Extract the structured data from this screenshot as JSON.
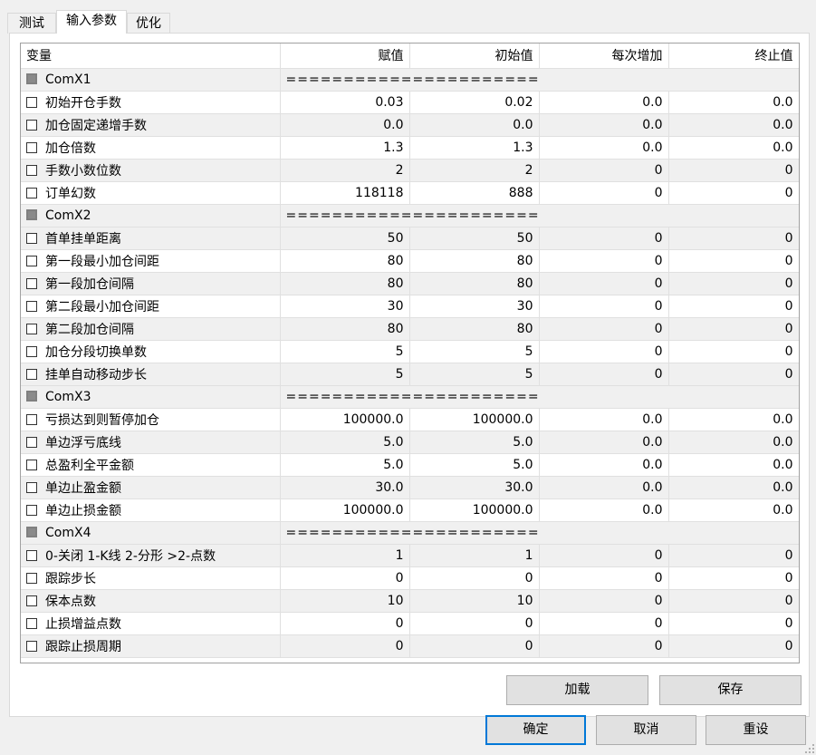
{
  "tabs": [
    {
      "label": "测试"
    },
    {
      "label": "输入参数"
    },
    {
      "label": "优化"
    }
  ],
  "table": {
    "headers": [
      "变量",
      "赋值",
      "初始值",
      "每次增加",
      "终止值"
    ],
    "separator": "=========================",
    "rows": [
      {
        "type": "group",
        "name": "ComX1"
      },
      {
        "type": "param",
        "name": "初始开仓手数",
        "value": "0.03",
        "start": "0.02",
        "step": "0.0",
        "stop": "0.0"
      },
      {
        "type": "param",
        "name": "加仓固定递增手数",
        "value": "0.0",
        "start": "0.0",
        "step": "0.0",
        "stop": "0.0"
      },
      {
        "type": "param",
        "name": "加仓倍数",
        "value": "1.3",
        "start": "1.3",
        "step": "0.0",
        "stop": "0.0"
      },
      {
        "type": "param",
        "name": "手数小数位数",
        "value": "2",
        "start": "2",
        "step": "0",
        "stop": "0"
      },
      {
        "type": "param",
        "name": "订单幻数",
        "value": "118118",
        "start": "888",
        "step": "0",
        "stop": "0"
      },
      {
        "type": "group",
        "name": "ComX2"
      },
      {
        "type": "param",
        "name": "首单挂单距离",
        "value": "50",
        "start": "50",
        "step": "0",
        "stop": "0"
      },
      {
        "type": "param",
        "name": "第一段最小加仓间距",
        "value": "80",
        "start": "80",
        "step": "0",
        "stop": "0"
      },
      {
        "type": "param",
        "name": "第一段加仓间隔",
        "value": "80",
        "start": "80",
        "step": "0",
        "stop": "0"
      },
      {
        "type": "param",
        "name": "第二段最小加仓间距",
        "value": "30",
        "start": "30",
        "step": "0",
        "stop": "0"
      },
      {
        "type": "param",
        "name": "第二段加仓间隔",
        "value": "80",
        "start": "80",
        "step": "0",
        "stop": "0"
      },
      {
        "type": "param",
        "name": "加仓分段切换单数",
        "value": "5",
        "start": "5",
        "step": "0",
        "stop": "0"
      },
      {
        "type": "param",
        "name": "挂单自动移动步长",
        "value": "5",
        "start": "5",
        "step": "0",
        "stop": "0"
      },
      {
        "type": "group",
        "name": "ComX3"
      },
      {
        "type": "param",
        "name": "亏损达到则暂停加仓",
        "value": "100000.0",
        "start": "100000.0",
        "step": "0.0",
        "stop": "0.0"
      },
      {
        "type": "param",
        "name": "单边浮亏底线",
        "value": "5.0",
        "start": "5.0",
        "step": "0.0",
        "stop": "0.0"
      },
      {
        "type": "param",
        "name": "总盈利全平金额",
        "value": "5.0",
        "start": "5.0",
        "step": "0.0",
        "stop": "0.0"
      },
      {
        "type": "param",
        "name": "单边止盈金额",
        "value": "30.0",
        "start": "30.0",
        "step": "0.0",
        "stop": "0.0"
      },
      {
        "type": "param",
        "name": "单边止损金额",
        "value": "100000.0",
        "start": "100000.0",
        "step": "0.0",
        "stop": "0.0"
      },
      {
        "type": "group",
        "name": "ComX4"
      },
      {
        "type": "param",
        "name": "0-关闭 1-K线 2-分形 >2-点数",
        "value": "1",
        "start": "1",
        "step": "0",
        "stop": "0"
      },
      {
        "type": "param",
        "name": "跟踪步长",
        "value": "0",
        "start": "0",
        "step": "0",
        "stop": "0"
      },
      {
        "type": "param",
        "name": "保本点数",
        "value": "10",
        "start": "10",
        "step": "0",
        "stop": "0"
      },
      {
        "type": "param",
        "name": "止损增益点数",
        "value": "0",
        "start": "0",
        "step": "0",
        "stop": "0"
      },
      {
        "type": "param",
        "name": "跟踪止损周期",
        "value": "0",
        "start": "0",
        "step": "0",
        "stop": "0"
      }
    ]
  },
  "buttons": {
    "load": "加载",
    "save": "保存",
    "ok": "确定",
    "cancel": "取消",
    "reset": "重设"
  },
  "colors": {
    "alt_row": "#f0f0f0",
    "default_button_border": "#0078d7"
  }
}
